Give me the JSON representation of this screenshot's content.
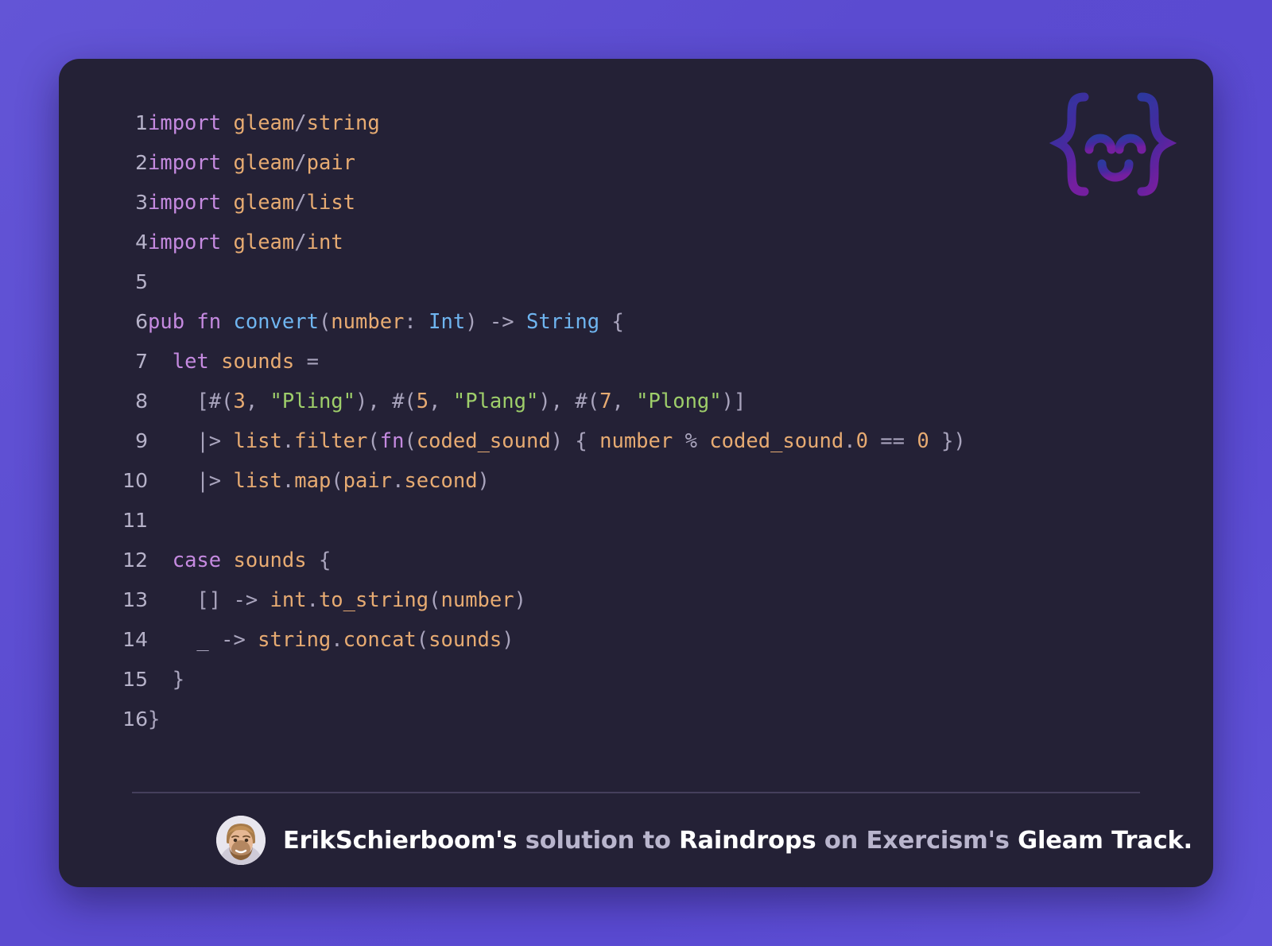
{
  "theme": {
    "page_background": "#5b4bd0",
    "card_background": "#242136",
    "divider": "#453f5c",
    "line_number_color": "#b6b2c9",
    "keyword_color": "#c58ae0",
    "module_color": "#e7ab72",
    "function_color": "#6fb5f0",
    "type_color": "#6fb5f0",
    "string_color": "#9ece6a",
    "number_color": "#e7ab72",
    "punctuation_color": "#a9a4bd",
    "footer_strong_color": "#ffffff",
    "footer_muted_color": "#b9b5cd",
    "watermark_gradient_start": "#2f3ba8",
    "watermark_gradient_end": "#7b1fa8"
  },
  "watermark": {
    "icon": "exercism-braces-smiley-icon",
    "label": "{ ^ ^ }"
  },
  "editor": {
    "language": "gleam",
    "first_line": 1,
    "last_line": 16,
    "lines": [
      {
        "number": "1",
        "tokens": [
          {
            "t": "import",
            "c": "kw"
          },
          {
            "t": " ",
            "c": "punc"
          },
          {
            "t": "gleam",
            "c": "mod"
          },
          {
            "t": "/",
            "c": "punc"
          },
          {
            "t": "string",
            "c": "mod"
          }
        ]
      },
      {
        "number": "2",
        "tokens": [
          {
            "t": "import",
            "c": "kw"
          },
          {
            "t": " ",
            "c": "punc"
          },
          {
            "t": "gleam",
            "c": "mod"
          },
          {
            "t": "/",
            "c": "punc"
          },
          {
            "t": "pair",
            "c": "mod"
          }
        ]
      },
      {
        "number": "3",
        "tokens": [
          {
            "t": "import",
            "c": "kw"
          },
          {
            "t": " ",
            "c": "punc"
          },
          {
            "t": "gleam",
            "c": "mod"
          },
          {
            "t": "/",
            "c": "punc"
          },
          {
            "t": "list",
            "c": "mod"
          }
        ]
      },
      {
        "number": "4",
        "tokens": [
          {
            "t": "import",
            "c": "kw"
          },
          {
            "t": " ",
            "c": "punc"
          },
          {
            "t": "gleam",
            "c": "mod"
          },
          {
            "t": "/",
            "c": "punc"
          },
          {
            "t": "int",
            "c": "mod"
          }
        ]
      },
      {
        "number": "5",
        "tokens": []
      },
      {
        "number": "6",
        "tokens": [
          {
            "t": "pub fn ",
            "c": "kw"
          },
          {
            "t": "convert",
            "c": "fnname"
          },
          {
            "t": "(",
            "c": "punc"
          },
          {
            "t": "number",
            "c": "id"
          },
          {
            "t": ": ",
            "c": "punc"
          },
          {
            "t": "Int",
            "c": "type"
          },
          {
            "t": ") -> ",
            "c": "punc"
          },
          {
            "t": "String",
            "c": "type"
          },
          {
            "t": " {",
            "c": "punc"
          }
        ]
      },
      {
        "number": "7",
        "tokens": [
          {
            "t": "  ",
            "c": "punc"
          },
          {
            "t": "let",
            "c": "kw"
          },
          {
            "t": " ",
            "c": "punc"
          },
          {
            "t": "sounds",
            "c": "id"
          },
          {
            "t": " =",
            "c": "punc"
          }
        ]
      },
      {
        "number": "8",
        "tokens": [
          {
            "t": "    [#(",
            "c": "punc"
          },
          {
            "t": "3",
            "c": "num"
          },
          {
            "t": ", ",
            "c": "punc"
          },
          {
            "t": "\"Pling\"",
            "c": "str"
          },
          {
            "t": "), #(",
            "c": "punc"
          },
          {
            "t": "5",
            "c": "num"
          },
          {
            "t": ", ",
            "c": "punc"
          },
          {
            "t": "\"Plang\"",
            "c": "str"
          },
          {
            "t": "), #(",
            "c": "punc"
          },
          {
            "t": "7",
            "c": "num"
          },
          {
            "t": ", ",
            "c": "punc"
          },
          {
            "t": "\"Plong\"",
            "c": "str"
          },
          {
            "t": ")]",
            "c": "punc"
          }
        ]
      },
      {
        "number": "9",
        "tokens": [
          {
            "t": "    |> ",
            "c": "punc"
          },
          {
            "t": "list",
            "c": "mod"
          },
          {
            "t": ".",
            "c": "punc"
          },
          {
            "t": "filter",
            "c": "mod"
          },
          {
            "t": "(",
            "c": "punc"
          },
          {
            "t": "fn",
            "c": "kw"
          },
          {
            "t": "(",
            "c": "punc"
          },
          {
            "t": "coded_sound",
            "c": "id"
          },
          {
            "t": ") { ",
            "c": "punc"
          },
          {
            "t": "number",
            "c": "id"
          },
          {
            "t": " % ",
            "c": "punc"
          },
          {
            "t": "coded_sound",
            "c": "id"
          },
          {
            "t": ".",
            "c": "punc"
          },
          {
            "t": "0",
            "c": "num"
          },
          {
            "t": " == ",
            "c": "punc"
          },
          {
            "t": "0",
            "c": "num"
          },
          {
            "t": " })",
            "c": "punc"
          }
        ]
      },
      {
        "number": "10",
        "tokens": [
          {
            "t": "    |> ",
            "c": "punc"
          },
          {
            "t": "list",
            "c": "mod"
          },
          {
            "t": ".",
            "c": "punc"
          },
          {
            "t": "map",
            "c": "mod"
          },
          {
            "t": "(",
            "c": "punc"
          },
          {
            "t": "pair",
            "c": "mod"
          },
          {
            "t": ".",
            "c": "punc"
          },
          {
            "t": "second",
            "c": "mod"
          },
          {
            "t": ")",
            "c": "punc"
          }
        ]
      },
      {
        "number": "11",
        "tokens": []
      },
      {
        "number": "12",
        "tokens": [
          {
            "t": "  ",
            "c": "punc"
          },
          {
            "t": "case",
            "c": "kw"
          },
          {
            "t": " ",
            "c": "punc"
          },
          {
            "t": "sounds",
            "c": "id"
          },
          {
            "t": " {",
            "c": "punc"
          }
        ]
      },
      {
        "number": "13",
        "tokens": [
          {
            "t": "    [] -> ",
            "c": "punc"
          },
          {
            "t": "int",
            "c": "mod"
          },
          {
            "t": ".",
            "c": "punc"
          },
          {
            "t": "to_string",
            "c": "mod"
          },
          {
            "t": "(",
            "c": "punc"
          },
          {
            "t": "number",
            "c": "id"
          },
          {
            "t": ")",
            "c": "punc"
          }
        ]
      },
      {
        "number": "14",
        "tokens": [
          {
            "t": "    _ -> ",
            "c": "punc"
          },
          {
            "t": "string",
            "c": "mod"
          },
          {
            "t": ".",
            "c": "punc"
          },
          {
            "t": "concat",
            "c": "mod"
          },
          {
            "t": "(",
            "c": "punc"
          },
          {
            "t": "sounds",
            "c": "id"
          },
          {
            "t": ")",
            "c": "punc"
          }
        ]
      },
      {
        "number": "15",
        "tokens": [
          {
            "t": "  }",
            "c": "punc"
          }
        ]
      },
      {
        "number": "16",
        "tokens": [
          {
            "t": "}",
            "c": "punc"
          }
        ]
      }
    ]
  },
  "footer": {
    "avatar": "user-avatar",
    "caption_segments": [
      {
        "text": "ErikSchierboom's",
        "emphasis": "strong"
      },
      {
        "text": " solution to ",
        "emphasis": "muted"
      },
      {
        "text": "Raindrops",
        "emphasis": "strong"
      },
      {
        "text": " on ",
        "emphasis": "muted"
      },
      {
        "text": "Exercism's",
        "emphasis": "muted"
      },
      {
        "text": " ",
        "emphasis": "muted"
      },
      {
        "text": "Gleam Track.",
        "emphasis": "strong"
      }
    ]
  }
}
